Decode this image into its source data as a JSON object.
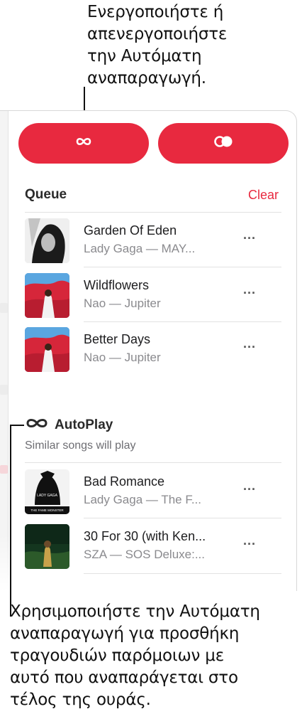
{
  "callouts": {
    "top": [
      "Ενεργοποιήστε ή",
      "απενεργοποιήστε",
      "την Αυτόματη",
      "αναπαραγωγή."
    ],
    "bottom": [
      "Χρησιμοποιήστε την Αυτόματη",
      "αναπαραγωγή για προσθήκη",
      "τραγουδιών παρόμοιων με",
      "αυτό που αναπαράγεται στο",
      "τέλος της ουράς."
    ]
  },
  "buttons": {
    "autoplay_icon": "infinity-icon",
    "repeat_icon": "autoplay-toggle-icon"
  },
  "queue": {
    "title": "Queue",
    "clear_label": "Clear",
    "more_label": "···",
    "items": [
      {
        "title": "Garden Of Eden",
        "subtitle": "Lady Gaga — MAY...",
        "art": "album-art-gaga"
      },
      {
        "title": "Wildflowers",
        "subtitle": "Nao — Jupiter",
        "art": "album-art-nao"
      },
      {
        "title": "Better Days",
        "subtitle": "Nao — Jupiter",
        "art": "album-art-nao"
      }
    ]
  },
  "autoplay": {
    "title": "AutoPlay",
    "subtitle": "Similar songs will play",
    "items": [
      {
        "title": "Bad Romance",
        "subtitle": "Lady Gaga — The F...",
        "art": "album-art-fame-monster"
      },
      {
        "title": "30 For 30 (with Ken...",
        "subtitle": "SZA — SOS Deluxe:...",
        "art": "album-art-sza"
      }
    ]
  },
  "album_text": {
    "fame_monster_line1": "LADY GAGA",
    "fame_monster_line2": "THE FAME MONSTER"
  },
  "colors": {
    "accent": "#e8293f",
    "text_primary": "#1d1d1f",
    "text_secondary": "#8a8a8e"
  }
}
